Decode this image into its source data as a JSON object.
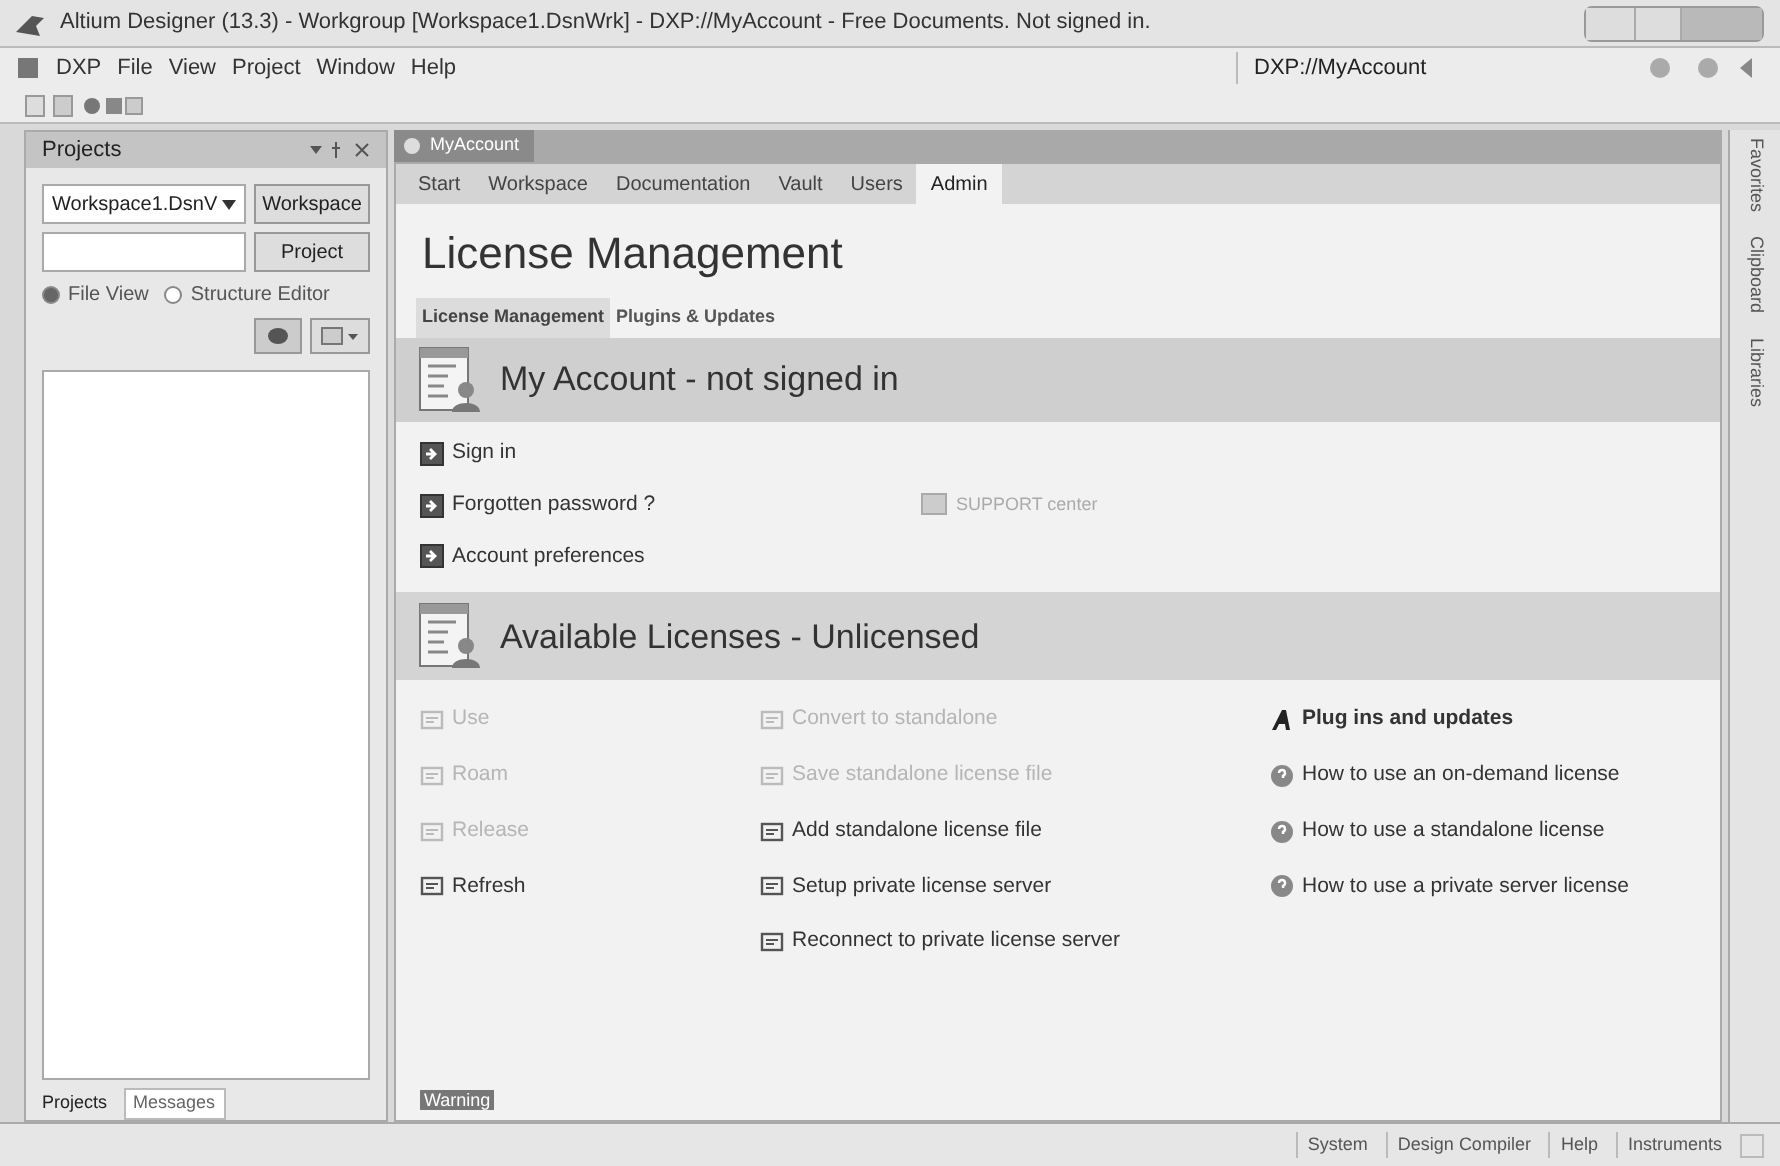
{
  "window": {
    "title": "Altium Designer (13.3) - Workgroup [Workspace1.DsnWrk] - DXP://MyAccount - Free Documents. Not signed in."
  },
  "menu": {
    "items": [
      "DXP",
      "File",
      "View",
      "Project",
      "Window",
      "Help"
    ]
  },
  "address_field": {
    "value": "DXP://MyAccount"
  },
  "projects_panel": {
    "title": "Projects",
    "workspace_dropdown": "Workspace1.DsnV",
    "buttons": [
      "Workspace",
      "Project"
    ],
    "views": [
      {
        "label": "File View",
        "selected": true
      },
      {
        "label": "Structure Editor",
        "selected": false
      }
    ],
    "bottom_tabs": [
      {
        "label": "Projects",
        "selected": true
      },
      {
        "label": "Messages",
        "selected": false
      }
    ]
  },
  "document_tab": "MyAccount",
  "nav_tabs": [
    {
      "label": "Start",
      "selected": false
    },
    {
      "label": "Workspace",
      "selected": false
    },
    {
      "label": "Documentation",
      "selected": false
    },
    {
      "label": "Vault",
      "selected": false
    },
    {
      "label": "Users",
      "selected": false
    },
    {
      "label": "Admin",
      "selected": true
    }
  ],
  "page_title": "License Management",
  "sub_tabs": [
    {
      "label": "License Management",
      "selected": true
    },
    {
      "label": "Plugins & Updates",
      "selected": false
    }
  ],
  "account_section": {
    "title": "My Account - not signed in",
    "links": [
      "Sign in",
      "Forgotten password ?",
      "Account preferences"
    ],
    "support": "SUPPORT center"
  },
  "licenses_section": {
    "title": "Available Licenses - Unlicensed",
    "columns": [
      [
        {
          "label": "Use",
          "disabled": true
        },
        {
          "label": "Roam",
          "disabled": true
        },
        {
          "label": "Release",
          "disabled": true
        },
        {
          "label": "Refresh",
          "disabled": false
        }
      ],
      [
        {
          "label": "Convert to standalone",
          "disabled": true
        },
        {
          "label": "Save standalone license file",
          "disabled": true
        },
        {
          "label": "Add standalone license file",
          "disabled": false
        },
        {
          "label": "Setup private license server",
          "disabled": false
        },
        {
          "label": "Reconnect to private license server",
          "disabled": false
        }
      ],
      [
        {
          "label": "Plug ins and updates",
          "kind": "plugin"
        },
        {
          "label": "How to use an on-demand license",
          "kind": "help"
        },
        {
          "label": "How to use a standalone license",
          "kind": "help"
        },
        {
          "label": "How to use a private server license",
          "kind": "help"
        }
      ]
    ]
  },
  "warning": "Warning",
  "side_tabs": [
    "Favorites",
    "Clipboard",
    "Libraries"
  ],
  "status_bar": [
    "System",
    "Design Compiler",
    "Help",
    "Instruments"
  ]
}
